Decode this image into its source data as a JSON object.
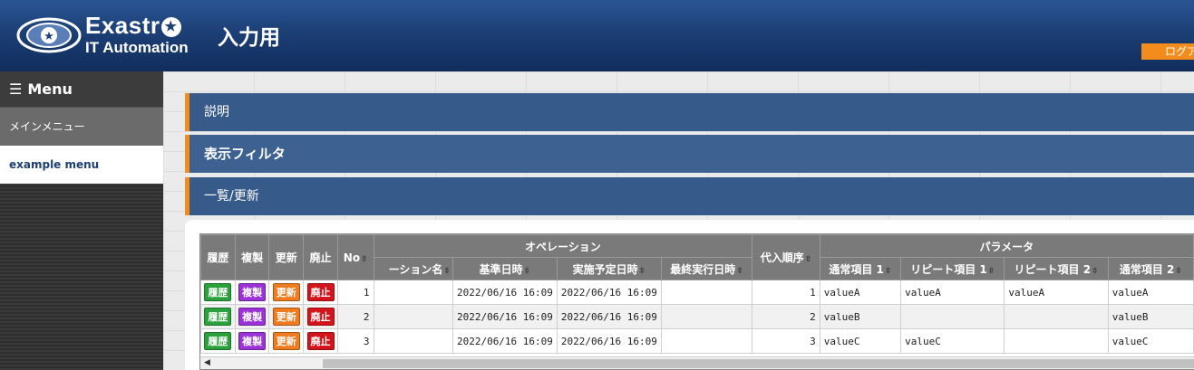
{
  "header": {
    "logo_line1": "Exastr",
    "logo_line2": "IT Automation",
    "title": "入力用",
    "logout_label": "ログアウト"
  },
  "sidebar": {
    "menu_label": "Menu",
    "items": [
      {
        "label": "メインメニュー"
      },
      {
        "label": "example menu"
      }
    ]
  },
  "sections": {
    "description": "説明",
    "filter": "表示フィルタ",
    "list": "一覧/更新"
  },
  "table": {
    "headers": {
      "history": "履歴",
      "copy": "複製",
      "update": "更新",
      "discard": "廃止",
      "no": "No",
      "operation_group": "オペレーション",
      "operation_name": "ーション名",
      "base_date": "基準日時",
      "scheduled_date": "実施予定日時",
      "last_exec_date": "最終実行日時",
      "order": "代入順序",
      "param_group": "パラメータ",
      "normal1": "通常項目 1",
      "repeat1": "リピート項目 1",
      "repeat2": "リピート項目 2",
      "normal2": "通常項目 2"
    },
    "button_labels": {
      "history": "履歴",
      "copy": "複製",
      "update": "更新",
      "discard": "廃止"
    },
    "rows": [
      {
        "no": "1",
        "op_name": "",
        "base_date": "2022/06/16 16:09",
        "scheduled": "2022/06/16 16:09",
        "last_exec": "",
        "order": "1",
        "normal1": "valueA",
        "repeat1": "valueA",
        "repeat2": "valueA",
        "normal2": "valueA"
      },
      {
        "no": "2",
        "op_name": "",
        "base_date": "2022/06/16 16:09",
        "scheduled": "2022/06/16 16:09",
        "last_exec": "",
        "order": "2",
        "normal1": "valueB",
        "repeat1": "",
        "repeat2": "",
        "normal2": "valueB"
      },
      {
        "no": "3",
        "op_name": "",
        "base_date": "2022/06/16 16:09",
        "scheduled": "2022/06/16 16:09",
        "last_exec": "",
        "order": "3",
        "normal1": "valueC",
        "repeat1": "valueC",
        "repeat2": "",
        "normal2": "valueC"
      }
    ]
  },
  "colors": {
    "header": "#1c3f75",
    "accent": "#f28c1c",
    "section": "#365a8a"
  }
}
